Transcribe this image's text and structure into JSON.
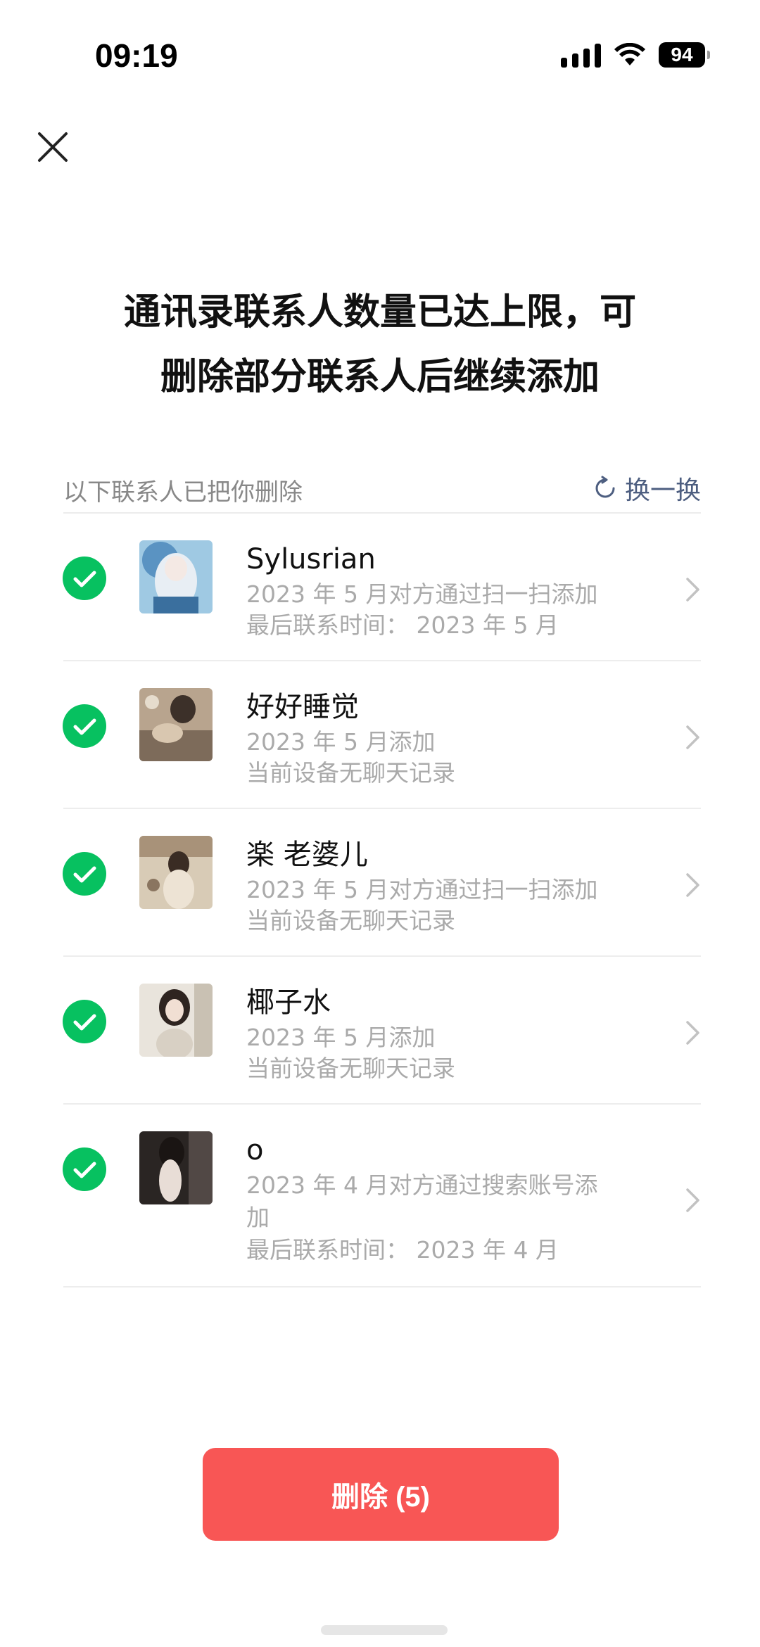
{
  "status_bar": {
    "time": "09:19",
    "battery": "94"
  },
  "headline": {
    "line1": "通讯录联系人数量已达上限，可",
    "line2": "删除部分联系人后继续添加"
  },
  "section": {
    "title": "以下联系人已把你删除",
    "refresh_label": "换一换"
  },
  "contacts": [
    {
      "name": "Sylusrian",
      "line1": "2023 年 5 月对方通过扫一扫添加",
      "line2": "最后联系时间： 2023 年 5 月",
      "checked": true
    },
    {
      "name": "好好睡觉",
      "line1": "2023 年 5 月添加",
      "line2": "当前设备无聊天记录",
      "checked": true
    },
    {
      "name": "楽 老婆儿",
      "line1": "2023 年 5 月对方通过扫一扫添加",
      "line2": "当前设备无聊天记录",
      "checked": true
    },
    {
      "name": "椰子水",
      "line1": "2023 年 5 月添加",
      "line2": "当前设备无聊天记录",
      "checked": true
    },
    {
      "name": "o",
      "line1": "2023 年 4 月对方通过搜索账号添",
      "line1b": "加",
      "line2": "最后联系时间： 2023 年 4 月",
      "checked": true
    }
  ],
  "delete_button": {
    "label": "删除 (5)"
  },
  "colors": {
    "accent_green": "#07c160",
    "delete_red": "#f85655",
    "link_blue": "#4d5e80"
  }
}
